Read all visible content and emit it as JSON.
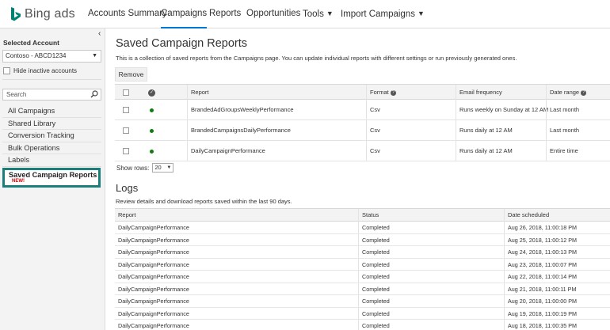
{
  "nav": {
    "logo_text": "Bing ads",
    "items": [
      {
        "label": "Accounts Summary"
      },
      {
        "label": "Campaigns"
      },
      {
        "label": "Reports"
      },
      {
        "label": "Opportunities"
      },
      {
        "label": "Tools"
      },
      {
        "label": "Import Campaigns"
      }
    ],
    "caret": "▼",
    "brand_color": "#0078d4"
  },
  "sidebar": {
    "collapse_glyph": "‹",
    "selected_account_label": "Selected Account",
    "account_value": "Contoso - ABCD1234",
    "hide_inactive_label": "Hide inactive accounts",
    "search_placeholder": "Search",
    "links": [
      {
        "label": "All Campaigns"
      },
      {
        "label": "Shared Library"
      },
      {
        "label": "Conversion Tracking"
      },
      {
        "label": "Bulk Operations"
      },
      {
        "label": "Labels"
      }
    ],
    "saved_reports_label": "Saved Campaign Reports",
    "new_badge": "NEW!",
    "highlight_color": "#1a7f7a"
  },
  "saved_reports": {
    "title": "Saved Campaign Reports",
    "description": "This is a collection of saved reports from the Campaigns page. You can update individual reports with different settings or run previously generated ones.",
    "remove_label": "Remove",
    "columns": {
      "report": "Report",
      "format": "Format",
      "email": "Email frequency",
      "date_range": "Date range"
    },
    "rows": [
      {
        "report": "BrandedAdGroupsWeeklyPerformance",
        "format": "Csv",
        "email": "Runs weekly on Sunday at 12 AM",
        "date_range": "Last month"
      },
      {
        "report": "BrandedCampaignsDailyPerformance",
        "format": "Csv",
        "email": "Runs daily at 12 AM",
        "date_range": "Last month"
      },
      {
        "report": "DailyCampaignPerformance",
        "format": "Csv",
        "email": "Runs daily at 12 AM",
        "date_range": "Entire time"
      }
    ],
    "show_rows_label": "Show rows:",
    "show_rows_value": "20"
  },
  "logs": {
    "title": "Logs",
    "description": "Review details and download reports saved within the last 90 days.",
    "columns": {
      "report": "Report",
      "status": "Status",
      "date_scheduled": "Date scheduled"
    },
    "rows": [
      {
        "report": "DailyCampaignPerformance",
        "status": "Completed",
        "date": "Aug 26, 2018, 11:00:18 PM"
      },
      {
        "report": "DailyCampaignPerformance",
        "status": "Completed",
        "date": "Aug 25, 2018, 11:00:12 PM"
      },
      {
        "report": "DailyCampaignPerformance",
        "status": "Completed",
        "date": "Aug 24, 2018, 11:00:13 PM"
      },
      {
        "report": "DailyCampaignPerformance",
        "status": "Completed",
        "date": "Aug 23, 2018, 11:00:07 PM"
      },
      {
        "report": "DailyCampaignPerformance",
        "status": "Completed",
        "date": "Aug 22, 2018, 11:00:14 PM"
      },
      {
        "report": "DailyCampaignPerformance",
        "status": "Completed",
        "date": "Aug 21, 2018, 11:00:11 PM"
      },
      {
        "report": "DailyCampaignPerformance",
        "status": "Completed",
        "date": "Aug 20, 2018, 11:00:00 PM"
      },
      {
        "report": "DailyCampaignPerformance",
        "status": "Completed",
        "date": "Aug 19, 2018, 11:00:19 PM"
      },
      {
        "report": "DailyCampaignPerformance",
        "status": "Completed",
        "date": "Aug 18, 2018, 11:00:35 PM"
      }
    ]
  }
}
